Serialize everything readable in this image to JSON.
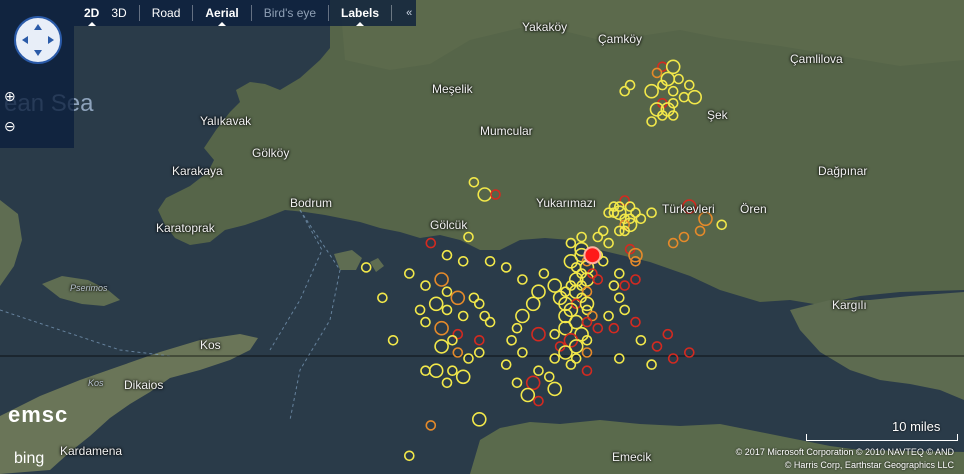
{
  "toolbar": {
    "view_2d": "2D",
    "view_3d": "3D",
    "road": "Road",
    "aerial": "Aerial",
    "birds_eye": "Bird's eye",
    "labels": "Labels",
    "collapse": "«"
  },
  "zoom": {
    "in": "⊕",
    "out": "⊖"
  },
  "places": [
    {
      "name": "Yakaköy",
      "cls": ""
    },
    {
      "name": "Çamköy",
      "cls": ""
    },
    {
      "name": "Çamlilova",
      "cls": ""
    },
    {
      "name": "Meşelik",
      "cls": ""
    },
    {
      "name": "Mumcular",
      "cls": ""
    },
    {
      "name": "Şek",
      "cls": ""
    },
    {
      "name": "Yalıkavak",
      "cls": ""
    },
    {
      "name": "Gölköy",
      "cls": ""
    },
    {
      "name": "Karakaya",
      "cls": ""
    },
    {
      "name": "Dağpınar",
      "cls": ""
    },
    {
      "name": "Bodrum",
      "cls": ""
    },
    {
      "name": "Gölcük",
      "cls": ""
    },
    {
      "name": "Yukarımazı",
      "cls": ""
    },
    {
      "name": "Türkevleri",
      "cls": ""
    },
    {
      "name": "Ören",
      "cls": ""
    },
    {
      "name": "Karatoprak",
      "cls": ""
    },
    {
      "name": "Pserimos",
      "cls": "small"
    },
    {
      "name": "Kargılı",
      "cls": ""
    },
    {
      "name": "Kos",
      "cls": ""
    },
    {
      "name": "Kos",
      "cls": "small"
    },
    {
      "name": "Dikaios",
      "cls": ""
    },
    {
      "name": "Emecik",
      "cls": ""
    },
    {
      "name": "Kardamena",
      "cls": ""
    },
    {
      "name": "ean Sea",
      "cls": "sea"
    }
  ],
  "logos": {
    "emsc": "emsc",
    "bing": "bing"
  },
  "scale_label": "10 miles",
  "copyright_line1": "© 2017 Microsoft Corporation  © 2010 NAVTEQ  © AND",
  "copyright_line2": "© Harris Corp, Earthstar Geographics LLC",
  "colors": {
    "yellow": "#f2e84a",
    "orange": "#e58a2a",
    "red": "#d42a20",
    "mainshock": "#ff1a1a",
    "land": "#566549",
    "sea": "#2a3b49"
  },
  "earthquakes": {
    "mainshock": {
      "lat": 37.03,
      "lon": 27.51
    },
    "events": [
      {
        "lat": 37.11,
        "lon": 27.55,
        "c": "yellow",
        "m": 2
      },
      {
        "lat": 37.12,
        "lon": 27.57,
        "c": "red",
        "m": 2
      },
      {
        "lat": 37.11,
        "lon": 27.56,
        "c": "yellow",
        "m": 2
      },
      {
        "lat": 37.1,
        "lon": 27.55,
        "c": "yellow",
        "m": 2
      },
      {
        "lat": 37.1,
        "lon": 27.56,
        "c": "yellow",
        "m": 3
      },
      {
        "lat": 37.09,
        "lon": 27.57,
        "c": "yellow",
        "m": 2
      },
      {
        "lat": 37.09,
        "lon": 27.58,
        "c": "yellow",
        "m": 2
      },
      {
        "lat": 37.08,
        "lon": 27.57,
        "c": "orange",
        "m": 2
      },
      {
        "lat": 37.08,
        "lon": 27.58,
        "c": "yellow",
        "m": 3
      },
      {
        "lat": 37.1,
        "lon": 27.54,
        "c": "yellow",
        "m": 2
      },
      {
        "lat": 37.1,
        "lon": 27.59,
        "c": "yellow",
        "m": 2
      },
      {
        "lat": 37.09,
        "lon": 27.6,
        "c": "yellow",
        "m": 2
      },
      {
        "lat": 37.07,
        "lon": 27.56,
        "c": "yellow",
        "m": 2
      },
      {
        "lat": 37.11,
        "lon": 27.58,
        "c": "yellow",
        "m": 2
      },
      {
        "lat": 37.07,
        "lon": 27.57,
        "c": "yellow",
        "m": 2
      },
      {
        "lat": 37.04,
        "lon": 27.58,
        "c": "red",
        "m": 2
      },
      {
        "lat": 37.03,
        "lon": 27.59,
        "c": "orange",
        "m": 3
      },
      {
        "lat": 37.02,
        "lon": 27.59,
        "c": "orange",
        "m": 2
      },
      {
        "lat": 37.04,
        "lon": 27.49,
        "c": "yellow",
        "m": 3
      },
      {
        "lat": 37.03,
        "lon": 27.49,
        "c": "yellow",
        "m": 3
      },
      {
        "lat": 37.02,
        "lon": 27.5,
        "c": "orange",
        "m": 2
      },
      {
        "lat": 37.03,
        "lon": 27.52,
        "c": "yellow",
        "m": 2
      },
      {
        "lat": 37.02,
        "lon": 27.53,
        "c": "yellow",
        "m": 2
      },
      {
        "lat": 37.02,
        "lon": 27.47,
        "c": "yellow",
        "m": 3
      },
      {
        "lat": 37.01,
        "lon": 27.48,
        "c": "yellow",
        "m": 2
      },
      {
        "lat": 37.01,
        "lon": 27.5,
        "c": "yellow",
        "m": 3
      },
      {
        "lat": 37.0,
        "lon": 27.51,
        "c": "red",
        "m": 2
      },
      {
        "lat": 37.0,
        "lon": 27.49,
        "c": "yellow",
        "m": 2
      },
      {
        "lat": 36.99,
        "lon": 27.48,
        "c": "yellow",
        "m": 3
      },
      {
        "lat": 36.99,
        "lon": 27.5,
        "c": "yellow",
        "m": 3
      },
      {
        "lat": 36.99,
        "lon": 27.52,
        "c": "red",
        "m": 2
      },
      {
        "lat": 36.98,
        "lon": 27.49,
        "c": "yellow",
        "m": 2
      },
      {
        "lat": 36.98,
        "lon": 27.47,
        "c": "yellow",
        "m": 2
      },
      {
        "lat": 36.98,
        "lon": 27.44,
        "c": "yellow",
        "m": 3
      },
      {
        "lat": 36.97,
        "lon": 27.46,
        "c": "yellow",
        "m": 2
      },
      {
        "lat": 36.97,
        "lon": 27.48,
        "c": "yellow",
        "m": 3
      },
      {
        "lat": 36.97,
        "lon": 27.5,
        "c": "orange",
        "m": 2
      },
      {
        "lat": 36.96,
        "lon": 27.49,
        "c": "yellow",
        "m": 2
      },
      {
        "lat": 36.96,
        "lon": 27.45,
        "c": "yellow",
        "m": 3
      },
      {
        "lat": 36.95,
        "lon": 27.46,
        "c": "yellow",
        "m": 3
      },
      {
        "lat": 36.95,
        "lon": 27.48,
        "c": "red",
        "m": 2
      },
      {
        "lat": 36.95,
        "lon": 27.5,
        "c": "yellow",
        "m": 3
      },
      {
        "lat": 36.94,
        "lon": 27.47,
        "c": "yellow",
        "m": 3
      },
      {
        "lat": 36.94,
        "lon": 27.5,
        "c": "yellow",
        "m": 2
      },
      {
        "lat": 36.93,
        "lon": 27.46,
        "c": "yellow",
        "m": 3
      },
      {
        "lat": 36.93,
        "lon": 27.51,
        "c": "orange",
        "m": 2
      },
      {
        "lat": 36.92,
        "lon": 27.48,
        "c": "yellow",
        "m": 3
      },
      {
        "lat": 36.92,
        "lon": 27.5,
        "c": "red",
        "m": 2
      },
      {
        "lat": 36.91,
        "lon": 27.46,
        "c": "yellow",
        "m": 3
      },
      {
        "lat": 36.91,
        "lon": 27.52,
        "c": "red",
        "m": 2
      },
      {
        "lat": 36.9,
        "lon": 27.49,
        "c": "yellow",
        "m": 3
      },
      {
        "lat": 36.9,
        "lon": 27.44,
        "c": "yellow",
        "m": 2
      },
      {
        "lat": 36.89,
        "lon": 27.47,
        "c": "red",
        "m": 3
      },
      {
        "lat": 36.89,
        "lon": 27.5,
        "c": "yellow",
        "m": 2
      },
      {
        "lat": 36.88,
        "lon": 27.45,
        "c": "red",
        "m": 2
      },
      {
        "lat": 36.88,
        "lon": 27.48,
        "c": "yellow",
        "m": 3
      },
      {
        "lat": 36.87,
        "lon": 27.46,
        "c": "yellow",
        "m": 3
      },
      {
        "lat": 36.87,
        "lon": 27.5,
        "c": "orange",
        "m": 2
      },
      {
        "lat": 36.86,
        "lon": 27.44,
        "c": "yellow",
        "m": 2
      },
      {
        "lat": 36.86,
        "lon": 27.48,
        "c": "yellow",
        "m": 2
      },
      {
        "lat": 36.85,
        "lon": 27.47,
        "c": "yellow",
        "m": 2
      },
      {
        "lat": 36.84,
        "lon": 27.5,
        "c": "red",
        "m": 2
      },
      {
        "lat": 36.84,
        "lon": 27.41,
        "c": "yellow",
        "m": 2
      },
      {
        "lat": 36.83,
        "lon": 27.43,
        "c": "yellow",
        "m": 2
      },
      {
        "lat": 36.9,
        "lon": 27.41,
        "c": "red",
        "m": 3
      },
      {
        "lat": 36.82,
        "lon": 27.4,
        "c": "red",
        "m": 3
      },
      {
        "lat": 36.81,
        "lon": 27.44,
        "c": "yellow",
        "m": 3
      },
      {
        "lat": 36.8,
        "lon": 27.39,
        "c": "yellow",
        "m": 3
      },
      {
        "lat": 36.79,
        "lon": 27.41,
        "c": "red",
        "m": 2
      },
      {
        "lat": 36.85,
        "lon": 27.35,
        "c": "yellow",
        "m": 2
      },
      {
        "lat": 36.82,
        "lon": 27.37,
        "c": "yellow",
        "m": 2
      },
      {
        "lat": 36.97,
        "lon": 27.41,
        "c": "yellow",
        "m": 3
      },
      {
        "lat": 36.95,
        "lon": 27.4,
        "c": "yellow",
        "m": 3
      },
      {
        "lat": 36.93,
        "lon": 27.38,
        "c": "yellow",
        "m": 3
      },
      {
        "lat": 36.91,
        "lon": 27.37,
        "c": "yellow",
        "m": 2
      },
      {
        "lat": 36.89,
        "lon": 27.36,
        "c": "yellow",
        "m": 2
      },
      {
        "lat": 36.87,
        "lon": 27.38,
        "c": "yellow",
        "m": 2
      },
      {
        "lat": 37.0,
        "lon": 27.42,
        "c": "yellow",
        "m": 2
      },
      {
        "lat": 36.99,
        "lon": 27.38,
        "c": "yellow",
        "m": 2
      },
      {
        "lat": 37.02,
        "lon": 27.32,
        "c": "yellow",
        "m": 2
      },
      {
        "lat": 37.01,
        "lon": 27.35,
        "c": "yellow",
        "m": 2
      },
      {
        "lat": 36.93,
        "lon": 27.54,
        "c": "yellow",
        "m": 2
      },
      {
        "lat": 36.91,
        "lon": 27.55,
        "c": "red",
        "m": 2
      },
      {
        "lat": 36.86,
        "lon": 27.56,
        "c": "yellow",
        "m": 2
      },
      {
        "lat": 36.89,
        "lon": 27.6,
        "c": "yellow",
        "m": 2
      },
      {
        "lat": 36.85,
        "lon": 27.62,
        "c": "yellow",
        "m": 2
      },
      {
        "lat": 36.88,
        "lon": 27.63,
        "c": "red",
        "m": 2
      },
      {
        "lat": 36.9,
        "lon": 27.65,
        "c": "red",
        "m": 2
      },
      {
        "lat": 36.87,
        "lon": 27.69,
        "c": "red",
        "m": 2
      },
      {
        "lat": 36.86,
        "lon": 27.66,
        "c": "red",
        "m": 2
      },
      {
        "lat": 36.92,
        "lon": 27.59,
        "c": "red",
        "m": 2
      },
      {
        "lat": 36.94,
        "lon": 27.57,
        "c": "yellow",
        "m": 2
      },
      {
        "lat": 36.96,
        "lon": 27.56,
        "c": "yellow",
        "m": 2
      },
      {
        "lat": 37.0,
        "lon": 27.56,
        "c": "yellow",
        "m": 2
      },
      {
        "lat": 36.98,
        "lon": 27.57,
        "c": "red",
        "m": 2
      },
      {
        "lat": 36.98,
        "lon": 27.55,
        "c": "yellow",
        "m": 2
      },
      {
        "lat": 36.99,
        "lon": 27.59,
        "c": "red",
        "m": 2
      },
      {
        "lat": 37.05,
        "lon": 27.54,
        "c": "yellow",
        "m": 2
      },
      {
        "lat": 37.06,
        "lon": 27.52,
        "c": "yellow",
        "m": 2
      },
      {
        "lat": 37.07,
        "lon": 27.53,
        "c": "yellow",
        "m": 2
      },
      {
        "lat": 37.06,
        "lon": 27.49,
        "c": "yellow",
        "m": 2
      },
      {
        "lat": 37.05,
        "lon": 27.47,
        "c": "yellow",
        "m": 2
      },
      {
        "lat": 37.11,
        "lon": 27.69,
        "c": "red",
        "m": 3
      },
      {
        "lat": 37.09,
        "lon": 27.72,
        "c": "orange",
        "m": 3
      },
      {
        "lat": 37.07,
        "lon": 27.71,
        "c": "orange",
        "m": 2
      },
      {
        "lat": 37.06,
        "lon": 27.68,
        "c": "orange",
        "m": 2
      },
      {
        "lat": 37.05,
        "lon": 27.66,
        "c": "orange",
        "m": 2
      },
      {
        "lat": 37.08,
        "lon": 27.75,
        "c": "yellow",
        "m": 2
      },
      {
        "lat": 37.1,
        "lon": 27.62,
        "c": "yellow",
        "m": 2
      },
      {
        "lat": 37.34,
        "lon": 27.64,
        "c": "red",
        "m": 2
      },
      {
        "lat": 37.34,
        "lon": 27.66,
        "c": "yellow",
        "m": 3
      },
      {
        "lat": 37.33,
        "lon": 27.63,
        "c": "orange",
        "m": 2
      },
      {
        "lat": 37.32,
        "lon": 27.65,
        "c": "yellow",
        "m": 3
      },
      {
        "lat": 37.32,
        "lon": 27.67,
        "c": "yellow",
        "m": 2
      },
      {
        "lat": 37.31,
        "lon": 27.64,
        "c": "yellow",
        "m": 2
      },
      {
        "lat": 37.31,
        "lon": 27.69,
        "c": "yellow",
        "m": 2
      },
      {
        "lat": 37.3,
        "lon": 27.62,
        "c": "yellow",
        "m": 3
      },
      {
        "lat": 37.3,
        "lon": 27.66,
        "c": "yellow",
        "m": 2
      },
      {
        "lat": 37.29,
        "lon": 27.68,
        "c": "yellow",
        "m": 2
      },
      {
        "lat": 37.29,
        "lon": 27.7,
        "c": "yellow",
        "m": 3
      },
      {
        "lat": 37.28,
        "lon": 27.64,
        "c": "red",
        "m": 2
      },
      {
        "lat": 37.28,
        "lon": 27.66,
        "c": "yellow",
        "m": 2
      },
      {
        "lat": 37.27,
        "lon": 27.63,
        "c": "yellow",
        "m": 3
      },
      {
        "lat": 37.27,
        "lon": 27.65,
        "c": "yellow",
        "m": 3
      },
      {
        "lat": 37.26,
        "lon": 27.64,
        "c": "yellow",
        "m": 2
      },
      {
        "lat": 37.26,
        "lon": 27.66,
        "c": "yellow",
        "m": 2
      },
      {
        "lat": 37.25,
        "lon": 27.62,
        "c": "yellow",
        "m": 2
      },
      {
        "lat": 37.31,
        "lon": 27.58,
        "c": "yellow",
        "m": 2
      },
      {
        "lat": 37.3,
        "lon": 27.57,
        "c": "yellow",
        "m": 2
      },
      {
        "lat": 37.13,
        "lon": 27.31,
        "c": "yellow",
        "m": 3
      },
      {
        "lat": 37.13,
        "lon": 27.33,
        "c": "red",
        "m": 2
      },
      {
        "lat": 37.15,
        "lon": 27.29,
        "c": "yellow",
        "m": 2
      },
      {
        "lat": 37.05,
        "lon": 27.21,
        "c": "red",
        "m": 2
      },
      {
        "lat": 37.03,
        "lon": 27.24,
        "c": "yellow",
        "m": 2
      },
      {
        "lat": 36.99,
        "lon": 27.23,
        "c": "orange",
        "m": 3
      },
      {
        "lat": 36.98,
        "lon": 27.2,
        "c": "yellow",
        "m": 2
      },
      {
        "lat": 36.97,
        "lon": 27.24,
        "c": "yellow",
        "m": 2
      },
      {
        "lat": 36.96,
        "lon": 27.26,
        "c": "orange",
        "m": 3
      },
      {
        "lat": 36.95,
        "lon": 27.22,
        "c": "yellow",
        "m": 3
      },
      {
        "lat": 36.94,
        "lon": 27.24,
        "c": "yellow",
        "m": 2
      },
      {
        "lat": 36.93,
        "lon": 27.27,
        "c": "yellow",
        "m": 2
      },
      {
        "lat": 36.92,
        "lon": 27.2,
        "c": "yellow",
        "m": 2
      },
      {
        "lat": 36.91,
        "lon": 27.23,
        "c": "orange",
        "m": 3
      },
      {
        "lat": 36.9,
        "lon": 27.26,
        "c": "red",
        "m": 2
      },
      {
        "lat": 36.89,
        "lon": 27.25,
        "c": "yellow",
        "m": 2
      },
      {
        "lat": 36.88,
        "lon": 27.23,
        "c": "yellow",
        "m": 3
      },
      {
        "lat": 36.87,
        "lon": 27.26,
        "c": "orange",
        "m": 2
      },
      {
        "lat": 36.86,
        "lon": 27.28,
        "c": "yellow",
        "m": 2
      },
      {
        "lat": 36.84,
        "lon": 27.25,
        "c": "yellow",
        "m": 2
      },
      {
        "lat": 36.84,
        "lon": 27.22,
        "c": "yellow",
        "m": 3
      },
      {
        "lat": 36.83,
        "lon": 27.27,
        "c": "yellow",
        "m": 3
      },
      {
        "lat": 36.82,
        "lon": 27.24,
        "c": "yellow",
        "m": 2
      },
      {
        "lat": 37.0,
        "lon": 27.17,
        "c": "yellow",
        "m": 2
      },
      {
        "lat": 36.94,
        "lon": 27.19,
        "c": "yellow",
        "m": 2
      },
      {
        "lat": 36.96,
        "lon": 27.29,
        "c": "yellow",
        "m": 2
      },
      {
        "lat": 36.95,
        "lon": 27.3,
        "c": "yellow",
        "m": 2
      },
      {
        "lat": 36.93,
        "lon": 27.31,
        "c": "yellow",
        "m": 2
      },
      {
        "lat": 36.92,
        "lon": 27.32,
        "c": "yellow",
        "m": 2
      },
      {
        "lat": 36.89,
        "lon": 27.3,
        "c": "red",
        "m": 2
      },
      {
        "lat": 36.87,
        "lon": 27.3,
        "c": "yellow",
        "m": 2
      },
      {
        "lat": 37.02,
        "lon": 27.27,
        "c": "yellow",
        "m": 2
      },
      {
        "lat": 37.06,
        "lon": 27.28,
        "c": "yellow",
        "m": 2
      },
      {
        "lat": 36.76,
        "lon": 27.3,
        "c": "yellow",
        "m": 3
      },
      {
        "lat": 36.7,
        "lon": 27.17,
        "c": "yellow",
        "m": 2
      },
      {
        "lat": 36.75,
        "lon": 27.21,
        "c": "orange",
        "m": 2
      },
      {
        "lat": 36.89,
        "lon": 27.14,
        "c": "yellow",
        "m": 2
      },
      {
        "lat": 36.96,
        "lon": 27.12,
        "c": "yellow",
        "m": 2
      },
      {
        "lat": 37.01,
        "lon": 27.09,
        "c": "yellow",
        "m": 2
      },
      {
        "lat": 36.84,
        "lon": 27.2,
        "c": "yellow",
        "m": 2
      }
    ]
  }
}
